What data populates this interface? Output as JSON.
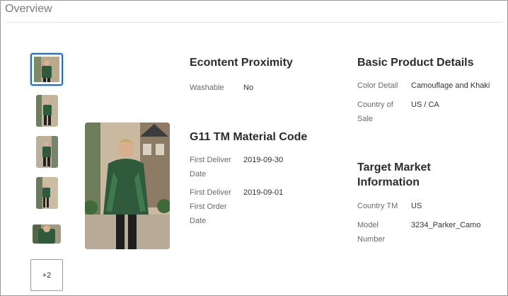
{
  "page": {
    "title": "Overview"
  },
  "gallery": {
    "more_label": "+2",
    "thumb_count": 5
  },
  "sections": {
    "econtent": {
      "heading": "Econtent Proximity",
      "rows": [
        {
          "label": "Washable",
          "value": "No"
        }
      ]
    },
    "material": {
      "heading": "G11 TM Material Code",
      "rows": [
        {
          "label_line1": "First Deliver",
          "label_line2": "Date",
          "value": "2019-09-30"
        },
        {
          "label_line1": "First Deliver",
          "label_line2": "First Order",
          "label_line3": "Date",
          "value": "2019-09-01"
        }
      ]
    },
    "basic": {
      "heading": "Basic Product Details",
      "rows": [
        {
          "label": "Color Detail",
          "value": "Camouflage and Khaki"
        },
        {
          "label_line1": "Country of",
          "label_line2": "Sale",
          "value": "US / CA"
        }
      ]
    },
    "target": {
      "heading_line1": "Target Market",
      "heading_line2": "Information",
      "rows": [
        {
          "label": "Country TM",
          "value": "US"
        },
        {
          "label_line1": "Model",
          "label_line2": "Number",
          "value": "3234_Parker_Camo"
        }
      ]
    }
  },
  "colors": {
    "accent": "#1b6fc2",
    "border": "#9a9a9a",
    "jacket": "#2f5a3c"
  }
}
